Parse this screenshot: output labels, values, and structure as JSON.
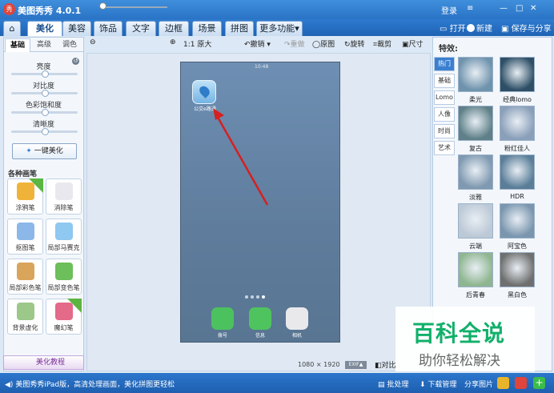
{
  "window": {
    "title": "美图秀秀 4.0.1",
    "login": "登录"
  },
  "tabs": [
    "美化",
    "美容",
    "饰品",
    "文字",
    "边框",
    "场景",
    "拼图",
    "更多功能"
  ],
  "active_tab": "美化",
  "top_actions": {
    "open": "打开",
    "new": "新建",
    "save": "保存与分享"
  },
  "left": {
    "subtabs": [
      "基础",
      "高级",
      "调色"
    ],
    "adjustments": [
      {
        "label": "亮度",
        "value": 0.5
      },
      {
        "label": "对比度",
        "value": 0.5
      },
      {
        "label": "色彩饱和度",
        "value": 0.5
      },
      {
        "label": "清晰度",
        "value": 0.5
      }
    ],
    "one_key": "一键美化",
    "brush_heading": "各种画笔",
    "brushes": [
      "涂鸦笔",
      "消除笔",
      "抠图笔",
      "局部马赛克",
      "局部彩色笔",
      "局部变色笔",
      "背景虚化",
      "魔幻笔"
    ],
    "tutorial": "美化教程"
  },
  "toolbar": {
    "zoom_actual": "1:1 原大",
    "undo": "撤销",
    "redo": "重做",
    "original": "原图",
    "rotate": "旋转",
    "crop": "裁剪",
    "size": "尺寸"
  },
  "phone": {
    "app_label": "公交e路通",
    "time": "10:48",
    "dock": [
      "拨号",
      "信息",
      "相机"
    ]
  },
  "canvas_info": {
    "width": "1080",
    "times": "×",
    "height": "1920",
    "exif": "EXIF▲",
    "compare": "对比"
  },
  "effects": {
    "heading": "特效:",
    "categories": [
      "热门",
      "基础",
      "Lomo",
      "人像",
      "时尚",
      "艺术"
    ],
    "items": [
      {
        "label": "柔光",
        "color": "#6f93ad"
      },
      {
        "label": "经典lomo",
        "color": "#2e4f66"
      },
      {
        "label": "复古",
        "color": "#5f8088"
      },
      {
        "label": "粉红佳人",
        "color": "#8a9fb9"
      },
      {
        "label": "淡雅",
        "color": "#7f99b0"
      },
      {
        "label": "HDR",
        "color": "#5a7d98"
      },
      {
        "label": "云端",
        "color": "#bcc9d6"
      },
      {
        "label": "阿宝色",
        "color": "#7a96ae"
      },
      {
        "label": "后青春",
        "color": "#8fb690"
      },
      {
        "label": "黑白色",
        "color": "#6f6f6f"
      }
    ]
  },
  "watermark": {
    "title": "百科全说",
    "subtitle": "助你轻松解决"
  },
  "footer": {
    "tip": "美图秀秀iPad版，高清处理画面，美化拼图更轻松",
    "batch": "批处理",
    "download": "下载管理",
    "share": "分享图片"
  }
}
